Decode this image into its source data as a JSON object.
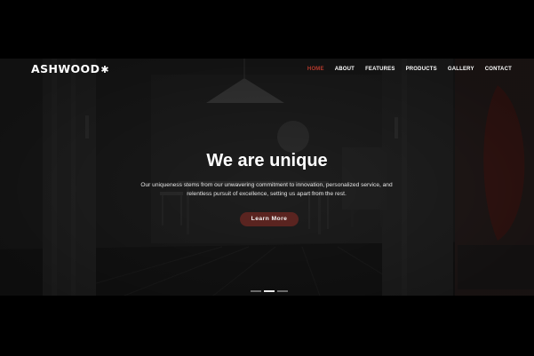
{
  "brand": {
    "name": "ASHWOOD",
    "logo_icon": "palm-tree-icon",
    "logo_glyph": "✱"
  },
  "nav": {
    "items": [
      {
        "label": "HOME",
        "active": true
      },
      {
        "label": "ABOUT"
      },
      {
        "label": "FEATURES"
      },
      {
        "label": "PRODUCTS"
      },
      {
        "label": "GALLERY"
      },
      {
        "label": "CONTACT"
      }
    ]
  },
  "hero": {
    "title": "We are unique",
    "subtitle": "Our uniqueness stems from our unwavering commitment to innovation, personalized service, and relentless pursuit of excellence, setting us apart from the rest.",
    "cta_label": "Learn More"
  },
  "slider": {
    "count": 3,
    "active_index": 1
  },
  "colors": {
    "accent": "#b5392c",
    "button_bg": "#5a2420",
    "page_bg": "#000000"
  }
}
